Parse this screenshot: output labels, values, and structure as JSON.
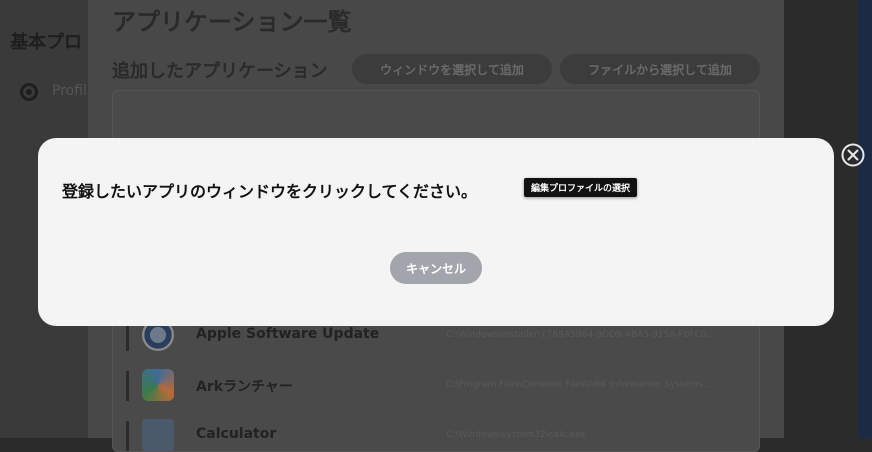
{
  "background": {
    "sidebar_title": "基本プロ",
    "sidebar_item": "Profil",
    "panel_title": "アプリケーション一覧",
    "section_title": "追加したアプリケーション",
    "add_by_window": "ウィンドウを選択して追加",
    "add_by_file": "ファイルから選択して追加",
    "apps": [
      {
        "name": "Apple Software Update",
        "path": "C:\\Windows\\Installer\\{789A5B64-9DD9-4BA5-915A-F0FC0...",
        "icon": "apple-update-icon"
      },
      {
        "name": "Arkランチャー",
        "path": "C:\\Program Files\\Common Files\\ARK Information Systems...",
        "icon": "ark-launcher-icon"
      },
      {
        "name": "Calculator",
        "path": "C:\\Windows\\system32\\calc.exe",
        "icon": "calculator-icon"
      }
    ]
  },
  "modal": {
    "message": "登録したいアプリのウィンドウをクリックしてください。",
    "tooltip": "編集プロファイルの選択",
    "cancel_label": "キャンセル"
  },
  "colors": {
    "modal_bg": "#f4f4f4",
    "cancel_bg": "#a3a5ac",
    "overlay": "#484848"
  }
}
